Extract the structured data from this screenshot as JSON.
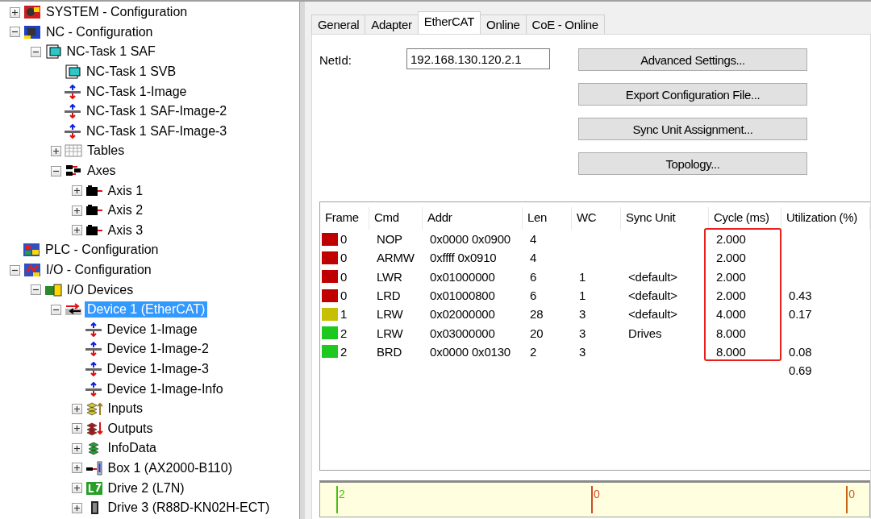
{
  "tree": [
    {
      "label": "SYSTEM - Configuration",
      "kind": "system",
      "expanded": false,
      "selected": false
    },
    {
      "label": "NC - Configuration",
      "kind": "nc",
      "expanded": true,
      "selected": false,
      "children": [
        {
          "label": "NC-Task 1 SAF",
          "kind": "task",
          "expanded": true,
          "selected": false,
          "children": [
            {
              "label": "NC-Task 1 SVB",
              "kind": "task",
              "selected": false
            },
            {
              "label": "NC-Task 1-Image",
              "kind": "image",
              "selected": false
            },
            {
              "label": "NC-Task 1 SAF-Image-2",
              "kind": "image",
              "selected": false
            },
            {
              "label": "NC-Task 1 SAF-Image-3",
              "kind": "image",
              "selected": false
            },
            {
              "label": "Tables",
              "kind": "tables",
              "expanded": false,
              "selected": false
            },
            {
              "label": "Axes",
              "kind": "axes",
              "expanded": true,
              "selected": false,
              "children": [
                {
                  "label": "Axis 1",
                  "kind": "axis",
                  "expanded": false,
                  "selected": false
                },
                {
                  "label": "Axis 2",
                  "kind": "axis",
                  "expanded": false,
                  "selected": false
                },
                {
                  "label": "Axis 3",
                  "kind": "axis",
                  "expanded": false,
                  "selected": false
                }
              ]
            }
          ]
        }
      ]
    },
    {
      "label": "PLC - Configuration",
      "kind": "plc",
      "selected": false
    },
    {
      "label": "I/O - Configuration",
      "kind": "io",
      "expanded": true,
      "selected": false,
      "children": [
        {
          "label": "I/O Devices",
          "kind": "devices",
          "expanded": true,
          "selected": false,
          "children": [
            {
              "label": "Device 1 (EtherCAT)",
              "kind": "ethercat",
              "expanded": true,
              "selected": true,
              "children": [
                {
                  "label": "Device 1-Image",
                  "kind": "image",
                  "selected": false
                },
                {
                  "label": "Device 1-Image-2",
                  "kind": "image",
                  "selected": false
                },
                {
                  "label": "Device 1-Image-3",
                  "kind": "image",
                  "selected": false
                },
                {
                  "label": "Device 1-Image-Info",
                  "kind": "image",
                  "selected": false
                },
                {
                  "label": "Inputs",
                  "kind": "inputs",
                  "expanded": false,
                  "selected": false
                },
                {
                  "label": "Outputs",
                  "kind": "outputs",
                  "expanded": false,
                  "selected": false
                },
                {
                  "label": "InfoData",
                  "kind": "infodata",
                  "expanded": false,
                  "selected": false
                },
                {
                  "label": "Box 1 (AX2000-B110)",
                  "kind": "box",
                  "expanded": false,
                  "selected": false
                },
                {
                  "label": "Drive 2 (L7N)",
                  "kind": "l7",
                  "expanded": false,
                  "selected": false
                },
                {
                  "label": "Drive 3 (R88D-KN02H-ECT)",
                  "kind": "drive",
                  "expanded": false,
                  "selected": false
                }
              ]
            }
          ]
        }
      ]
    }
  ],
  "tabs": [
    {
      "label": "General",
      "selected": false
    },
    {
      "label": "Adapter",
      "selected": false
    },
    {
      "label": "EtherCAT",
      "selected": true
    },
    {
      "label": "Online",
      "selected": false
    },
    {
      "label": "CoE - Online",
      "selected": false
    }
  ],
  "net_id": {
    "label": "NetId:",
    "value": "192.168.130.120.2.1"
  },
  "buttons": [
    "Advanced Settings...",
    "Export Configuration File...",
    "Sync Unit Assignment...",
    "Topology..."
  ],
  "table": {
    "columns": [
      {
        "label": "Frame",
        "highlighted": false
      },
      {
        "label": "Cmd",
        "highlighted": false
      },
      {
        "label": "Addr",
        "highlighted": false
      },
      {
        "label": "Len",
        "highlighted": false
      },
      {
        "label": "WC",
        "highlighted": false
      },
      {
        "label": "Sync Unit",
        "highlighted": false
      },
      {
        "label": "Cycle (ms)",
        "highlighted": true
      },
      {
        "label": "Utilization (%)",
        "highlighted": false
      }
    ],
    "rows": [
      {
        "color": "#c00000",
        "cells": [
          "0",
          "NOP",
          "0x0000 0x0900",
          "4",
          null,
          null,
          "2.000",
          null
        ]
      },
      {
        "color": "#c00000",
        "cells": [
          "0",
          "ARMW",
          "0xffff 0x0910",
          "4",
          null,
          null,
          "2.000",
          null
        ]
      },
      {
        "color": "#c00000",
        "cells": [
          "0",
          "LWR",
          "0x01000000",
          "6",
          "1",
          "<default>",
          "2.000",
          null
        ]
      },
      {
        "color": "#c00000",
        "cells": [
          "0",
          "LRD",
          "0x01000800",
          "6",
          "1",
          "<default>",
          "2.000",
          "0.43"
        ]
      },
      {
        "color": "#c6c000",
        "cells": [
          "1",
          "LRW",
          "0x02000000",
          "28",
          "3",
          "<default>",
          "4.000",
          "0.17"
        ]
      },
      {
        "color": "#1ec81e",
        "cells": [
          "2",
          "LRW",
          "0x03000000",
          "20",
          "3",
          "Drives",
          "8.000",
          null
        ]
      },
      {
        "color": "#1ec81e",
        "cells": [
          "2",
          "BRD",
          "0x0000 0x0130",
          "2",
          "3",
          null,
          "8.000",
          "0.08"
        ]
      },
      {
        "cells": [
          null,
          null,
          null,
          null,
          null,
          null,
          null,
          "0.69"
        ]
      }
    ]
  },
  "timeline": {
    "markers": [
      {
        "label": "2",
        "color": "#4cbb17"
      },
      {
        "label": "0",
        "color": "#d04a2a"
      },
      {
        "label": "0",
        "color": "#c8641a"
      }
    ]
  }
}
